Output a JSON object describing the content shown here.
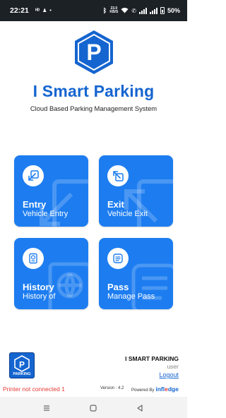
{
  "status_bar": {
    "time": "22:21",
    "icons_left": [
      "hd-voice-icon",
      "account-icon",
      "dot-icon"
    ],
    "net_speed_value": "23.0",
    "net_speed_unit": "KB/S",
    "battery": "50%"
  },
  "header": {
    "title": "I Smart Parking",
    "subtitle": "Cloud Based Parking Management System"
  },
  "tiles": [
    {
      "title": "Entry",
      "subtitle": "Vehicle Entry",
      "icon": "arrow-down-left-icon"
    },
    {
      "title": "Exit",
      "subtitle": "Vehicle Exit",
      "icon": "arrow-up-left-icon"
    },
    {
      "title": "History",
      "subtitle": "History of",
      "icon": "passport-icon"
    },
    {
      "title": "Pass",
      "subtitle": "Manage Pass",
      "icon": "list-icon"
    }
  ],
  "footer": {
    "logo_label": "PARKING",
    "company": "I SMART PARKING",
    "user": "user",
    "logout": "Logout",
    "printer_status": "Printer not connected 1",
    "version": "Version : 4.2",
    "powered_by": "Powered By",
    "brand_main": "infl",
    "brand_accent": "e",
    "brand_rest": "dge"
  },
  "colors": {
    "primary": "#1565d0",
    "tile": "#1d7df0",
    "error": "#e53935"
  }
}
